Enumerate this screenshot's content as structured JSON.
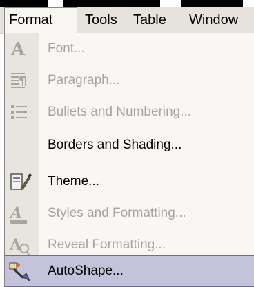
{
  "menubar": {
    "items": [
      {
        "label": "Format",
        "active": true
      },
      {
        "label": "Tools",
        "active": false
      },
      {
        "label": "Table",
        "active": false
      },
      {
        "label": "Window",
        "active": false
      }
    ]
  },
  "dropdown": {
    "items": [
      {
        "label": "Font...",
        "enabled": false,
        "icon": "font-icon"
      },
      {
        "label": "Paragraph...",
        "enabled": false,
        "icon": "paragraph-icon"
      },
      {
        "label": "Bullets and Numbering...",
        "enabled": false,
        "icon": "bullets-icon"
      },
      {
        "label": "Borders and Shading...",
        "enabled": true,
        "icon": null
      },
      {
        "label": "Theme...",
        "enabled": true,
        "icon": "theme-icon"
      },
      {
        "label": "Styles and Formatting...",
        "enabled": false,
        "icon": "styles-icon"
      },
      {
        "label": "Reveal Formatting...",
        "enabled": false,
        "icon": "reveal-formatting-icon"
      },
      {
        "label": "AutoShape...",
        "enabled": true,
        "selected": true,
        "icon": "autoshape-icon"
      }
    ]
  },
  "colors": {
    "menubar_bg": "#e6e3df",
    "dropdown_bg": "#f8f7f3",
    "icon_strip": "#e7e5df",
    "selection": "#c5c3dc",
    "disabled_text": "#a7a49f"
  }
}
